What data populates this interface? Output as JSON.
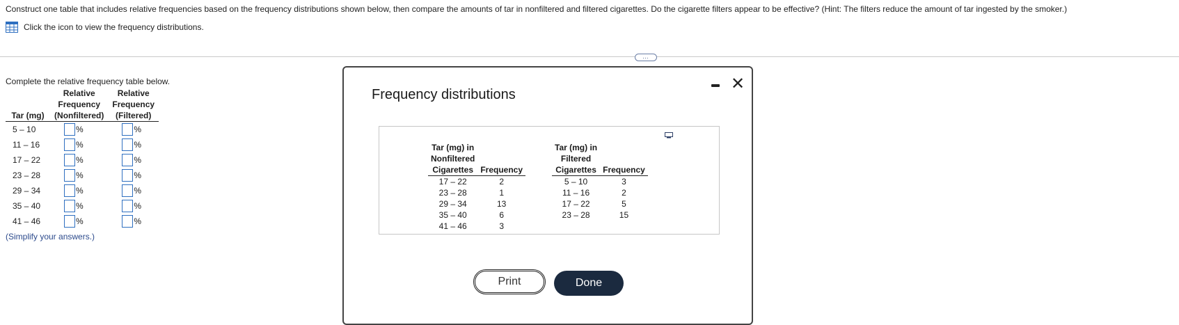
{
  "question": "Construct one table that includes relative frequencies based on the frequency distributions shown below, then compare the amounts of tar in nonfiltered and filtered cigarettes. Do the cigarette filters appear to be effective? (Hint: The filters reduce the amount of tar ingested by the smoker.)",
  "icon_link": {
    "icon": "table-icon",
    "text": "Click the icon to view the frequency distributions."
  },
  "more_button": "…",
  "relative_table": {
    "instruction": "Complete the relative frequency table below.",
    "headers": {
      "tar": "Tar (mg)",
      "nonfiltered_line1": "Relative",
      "nonfiltered_line2": "Frequency",
      "nonfiltered_line3": "(Nonfiltered)",
      "filtered_line1": "Relative",
      "filtered_line2": "Frequency",
      "filtered_line3": "(Filtered)"
    },
    "rows": [
      {
        "tar": "5 – 10",
        "nonfiltered": "",
        "filtered": ""
      },
      {
        "tar": "11 – 16",
        "nonfiltered": "",
        "filtered": ""
      },
      {
        "tar": "17 – 22",
        "nonfiltered": "",
        "filtered": ""
      },
      {
        "tar": "23 – 28",
        "nonfiltered": "",
        "filtered": ""
      },
      {
        "tar": "29 – 34",
        "nonfiltered": "",
        "filtered": ""
      },
      {
        "tar": "35 – 40",
        "nonfiltered": "",
        "filtered": ""
      },
      {
        "tar": "41 – 46",
        "nonfiltered": "",
        "filtered": ""
      }
    ],
    "unit": "%",
    "note": "(Simplify your answers.)"
  },
  "modal": {
    "title": "Frequency distributions",
    "minimize_icon": "minimize-icon",
    "close_icon": "close-icon",
    "close_glyph": "✕",
    "copy_icon": "copy-icon",
    "nonfiltered": {
      "header_line1": "Tar (mg) in",
      "header_line2": "Nonfiltered",
      "header_line3": "Cigarettes",
      "freq_header": "Frequency",
      "rows": [
        {
          "tar": "17 – 22",
          "freq": "2"
        },
        {
          "tar": "23 – 28",
          "freq": "1"
        },
        {
          "tar": "29 – 34",
          "freq": "13"
        },
        {
          "tar": "35 – 40",
          "freq": "6"
        },
        {
          "tar": "41 – 46",
          "freq": "3"
        }
      ]
    },
    "filtered": {
      "header_line1": "Tar (mg) in",
      "header_line2": "Filtered",
      "header_line3": "Cigarettes",
      "freq_header": "Frequency",
      "rows": [
        {
          "tar": "5 – 10",
          "freq": "3"
        },
        {
          "tar": "11 – 16",
          "freq": "2"
        },
        {
          "tar": "17 – 22",
          "freq": "5"
        },
        {
          "tar": "23 – 28",
          "freq": "15"
        }
      ]
    },
    "print_label": "Print",
    "done_label": "Done"
  }
}
